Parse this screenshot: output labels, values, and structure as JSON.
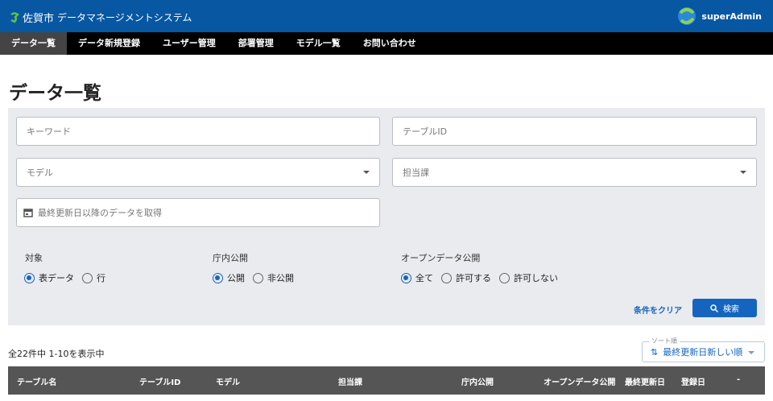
{
  "header": {
    "city": "佐賀市",
    "title": "データマネージメントシステム",
    "user": "superAdmin"
  },
  "nav": [
    "データ一覧",
    "データ新規登録",
    "ユーザー管理",
    "部署管理",
    "モデル一覧",
    "お問い合わせ"
  ],
  "page_title": "データ一覧",
  "filters": {
    "keyword_placeholder": "キーワード",
    "table_id_placeholder": "テーブルID",
    "model_placeholder": "モデル",
    "department_placeholder": "担当課",
    "date_placeholder": "最終更新日以降のデータを取得",
    "target": {
      "label": "対象",
      "options": [
        "表データ",
        "行"
      ],
      "selected": 0
    },
    "internal": {
      "label": "庁内公開",
      "options": [
        "公開",
        "非公開"
      ],
      "selected": 0
    },
    "opendata": {
      "label": "オープンデータ公開",
      "options": [
        "全て",
        "許可する",
        "許可しない"
      ],
      "selected": 0
    },
    "clear_label": "条件をクリア",
    "search_label": "検索"
  },
  "results": {
    "count_text": "全22件中 1-10を表示中",
    "sort_label": "ソート順",
    "sort_value": "最終更新日新しい順"
  },
  "table": {
    "columns": [
      "テーブル名",
      "テーブルID",
      "モデル",
      "担当課",
      "庁内公開",
      "オープンデータ公開",
      "最終更新日",
      "登録日",
      "-"
    ]
  },
  "colors": {
    "header": "#0757a3",
    "accent": "#1565c0"
  }
}
